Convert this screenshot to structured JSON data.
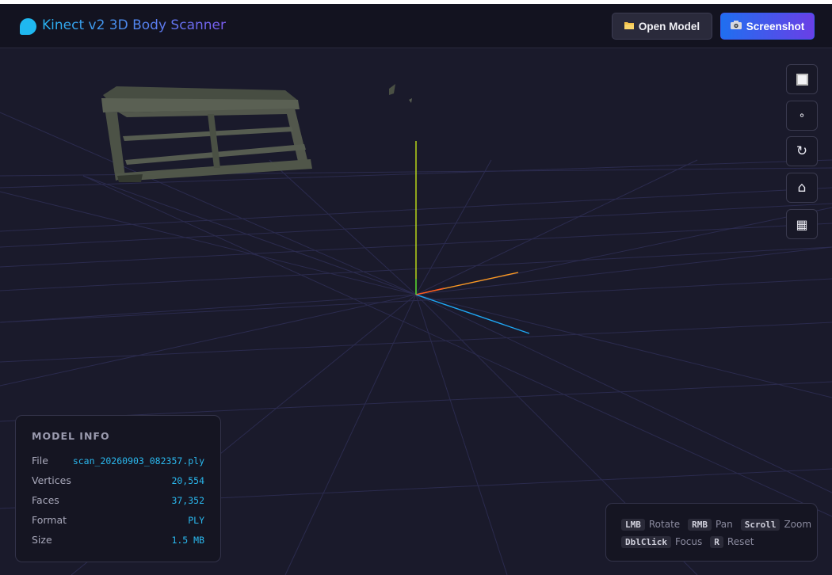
{
  "app": {
    "title": "Kinect v2 3D Body Scanner"
  },
  "toolbar": {
    "open_icon": "folder-icon",
    "open_label": "Open Model",
    "screenshot_icon": "camera-icon",
    "screenshot_label": "Screenshot"
  },
  "view_tools": [
    {
      "name": "solid-view-button",
      "icon": "square-icon",
      "glyph": "■"
    },
    {
      "name": "points-view-button",
      "icon": "dot-icon",
      "glyph": "∘"
    },
    {
      "name": "auto-rotate-button",
      "icon": "rotate-icon",
      "glyph": "↻"
    },
    {
      "name": "home-view-button",
      "icon": "home-icon",
      "glyph": "⌂"
    },
    {
      "name": "grid-toggle-button",
      "icon": "grid-icon",
      "glyph": "▦"
    }
  ],
  "model_info": {
    "heading": "MODEL INFO",
    "rows": [
      {
        "label": "File",
        "value": "scan_20260903_082357.ply"
      },
      {
        "label": "Vertices",
        "value": "20,554"
      },
      {
        "label": "Faces",
        "value": "37,352"
      },
      {
        "label": "Format",
        "value": "PLY"
      },
      {
        "label": "Size",
        "value": "1.5 MB"
      }
    ]
  },
  "controls_help": {
    "line1": [
      {
        "key": "LMB",
        "action": "Rotate"
      },
      {
        "key": "RMB",
        "action": "Pan"
      },
      {
        "key": "Scroll",
        "action": "Zoom"
      }
    ],
    "line2": [
      {
        "key": "DblClick",
        "action": "Focus"
      },
      {
        "key": "R",
        "action": "Reset"
      }
    ]
  },
  "colors": {
    "background": "#1a1a2b",
    "accent": "#1fb8f0",
    "axis_x": "#ff9a1f",
    "axis_y": "#b8e014",
    "axis_z": "#1fa8f5",
    "grid": "#2e2e52",
    "mesh": "#585e50"
  }
}
